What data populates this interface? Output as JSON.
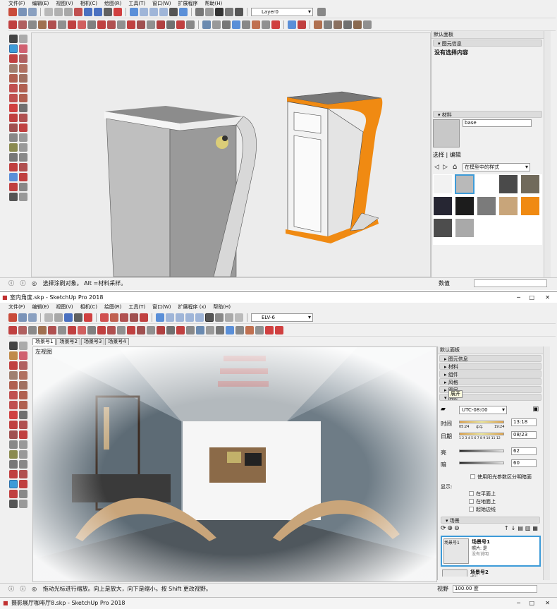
{
  "top": {
    "menu": [
      "文件(F)",
      "编辑(E)",
      "视图(V)",
      "相机(C)",
      "绘图(R)",
      "工具(T)",
      "窗口(W)",
      "扩展程序",
      "帮助(H)"
    ],
    "layer_value": "Layer0",
    "tray_title": "默认面板",
    "entity_info_title": "图元信息",
    "entity_info_text": "没有选择内容",
    "materials_title": "材料",
    "material_name": "base",
    "tab_select": "选择",
    "tab_edit": "编辑",
    "library_value": "在模型中的样式",
    "status_text": "选择涂刷对象。 Alt =材料采样。",
    "measure_label": "数值"
  },
  "bottom": {
    "window_title": "室内角度.skp - SketchUp Pro 2018",
    "menu": [
      "文件(F)",
      "编辑(E)",
      "视图(V)",
      "相机(C)",
      "绘图(R)",
      "工具(T)",
      "窗口(W)",
      "扩展程序 (x)",
      "帮助(H)"
    ],
    "layer_value": "ELV-6",
    "scene_tabs": [
      "场景号1",
      "场景号2",
      "场景号3",
      "场景号4"
    ],
    "view_label": "左视图",
    "tray_title": "默认面板",
    "sections": [
      "图元信息",
      "材料",
      "组件",
      "风格",
      "图层",
      "阴影"
    ],
    "tooltip": "展开",
    "timezone": "UTC-08:00",
    "time_label": "时间",
    "date_label": "日期",
    "time_start": "05:24",
    "time_mid": "中午",
    "time_end": "19:24",
    "time_value": "13:18",
    "date_value": "08/23",
    "months": "1 2 3 4 5 6 7 8 9 10 11 12",
    "light_label": "亮",
    "light_value": "62",
    "dark_label": "暗",
    "dark_value": "60",
    "use_sun_label": "使用阳光参数区分明暗面",
    "display_label": "显示:",
    "on_faces": "在平面上",
    "on_ground": "在地面上",
    "from_edges": "起始边线",
    "scenes_title": "场景",
    "scene1_name": "场景号1",
    "scene1_photo": "照片: 是",
    "scene1_desc": "没有说明",
    "scene1_thumb": "场景号1",
    "scene2_name": "场景号2",
    "scene2_photo": "照片",
    "status_text": "拖动光标进行缩放。向上是放大，向下是缩小。按 Shift 更改视野。",
    "measure_label": "视野",
    "measure_value": "100.00 度"
  },
  "taskbar_title": "摄影展厅咖啡厅8.skp - SketchUp Pro 2018",
  "colors": {
    "orange": "#f08a12",
    "select_blue": "#3d9bd8",
    "swatches": [
      "#f2f2f2",
      "#b9b9b9",
      "#ffffff",
      "#4a4a4a",
      "#716a5b",
      "#262633",
      "#1c1c1c",
      "#7b7b7b",
      "#c8a57a",
      "#f08a12",
      "#4d4d4d",
      "#a9a9a9"
    ]
  }
}
